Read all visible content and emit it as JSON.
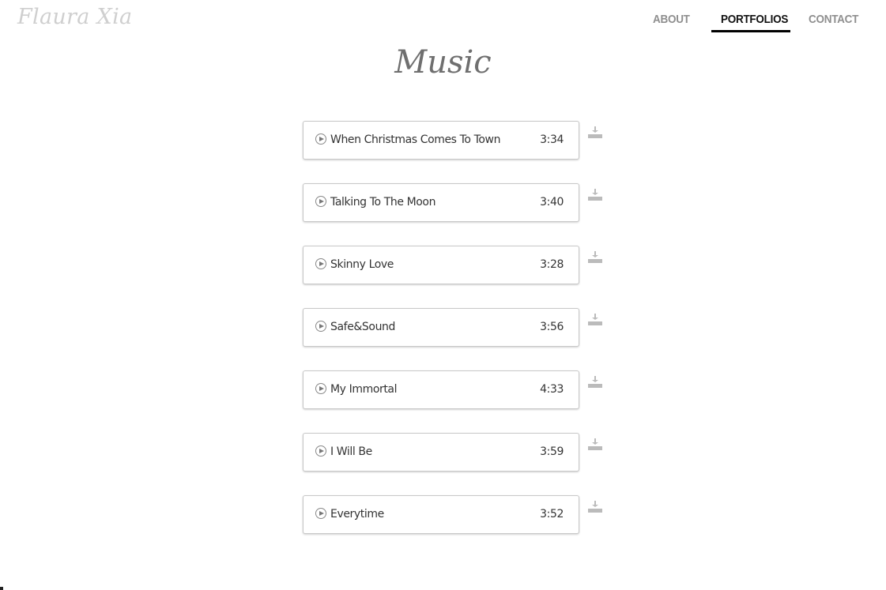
{
  "header": {
    "logo": "Flaura Xia",
    "nav": [
      {
        "label": "ABOUT",
        "active": false
      },
      {
        "label": "PORTFOLIOS",
        "active": true
      },
      {
        "label": "CONTACT",
        "active": false
      }
    ]
  },
  "page": {
    "title": "Music"
  },
  "tracks": [
    {
      "title": "When Christmas Comes To Town",
      "duration": "3:34",
      "icon": "play-icon",
      "action_icon": "download-icon"
    },
    {
      "title": "Talking To The Moon",
      "duration": "3:40",
      "icon": "play-icon",
      "action_icon": "download-icon"
    },
    {
      "title": "Skinny Love",
      "duration": "3:28",
      "icon": "play-icon",
      "action_icon": "download-icon"
    },
    {
      "title": "Safe&Sound",
      "duration": "3:56",
      "icon": "play-icon",
      "action_icon": "download-icon"
    },
    {
      "title": "My Immortal",
      "duration": "4:33",
      "icon": "play-icon",
      "action_icon": "download-icon"
    },
    {
      "title": "I Will Be",
      "duration": "3:59",
      "icon": "play-icon",
      "action_icon": "download-icon"
    },
    {
      "title": "Everytime",
      "duration": "3:52",
      "icon": "play-icon",
      "action_icon": "download-icon"
    }
  ],
  "colors": {
    "logo": "#cfcfcf",
    "nav_inactive": "#8f8f8f",
    "nav_active": "#111111",
    "title": "#6f6f6f"
  }
}
